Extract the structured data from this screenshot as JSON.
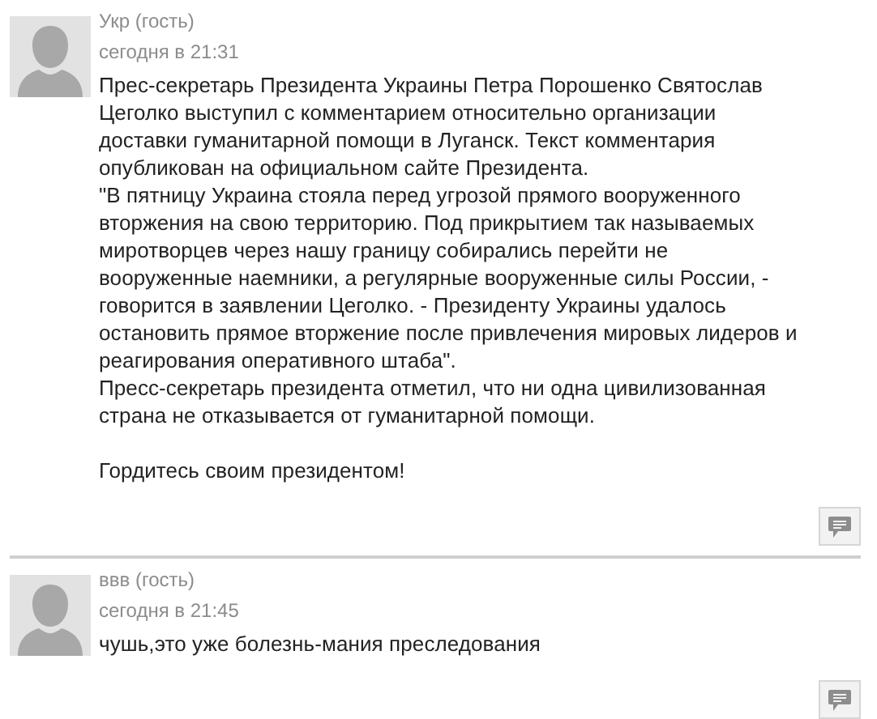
{
  "comments": [
    {
      "author": "Укр (гость)",
      "time": "сегодня в 21:31",
      "paragraphs": [
        "Прес-секретарь Президента Украины Петра Порошенко Святослав\nЦеголко выступил с комментарием относительно организации\nдоставки гуманитарной помощи в Луганск. Текст комментария\nопубликован на официальном сайте Президента.",
        "\"В пятницу Украина стояла перед угрозой прямого вооруженного\nвторжения на свою территорию. Под прикрытием так называемых\nмиротворцев через нашу границу собирались перейти не\nвооруженные наемники, а регулярные вооруженные силы России, -\nговорится в заявлении Цеголко. - Президенту Украины удалось\nостановить прямое вторжение после привлечения мировых лидеров и\nреагирования оперативного штаба\".",
        "Пресс-секретарь президента отметил, что ни одна цивилизованная\nстрана не отказывается от гуманитарной помощи.",
        "Гордитесь своим президентом!"
      ]
    },
    {
      "author": "ввв (гость)",
      "time": "сегодня в 21:45",
      "paragraphs": [
        "чушь,это уже болезнь-мания преследования"
      ]
    }
  ]
}
